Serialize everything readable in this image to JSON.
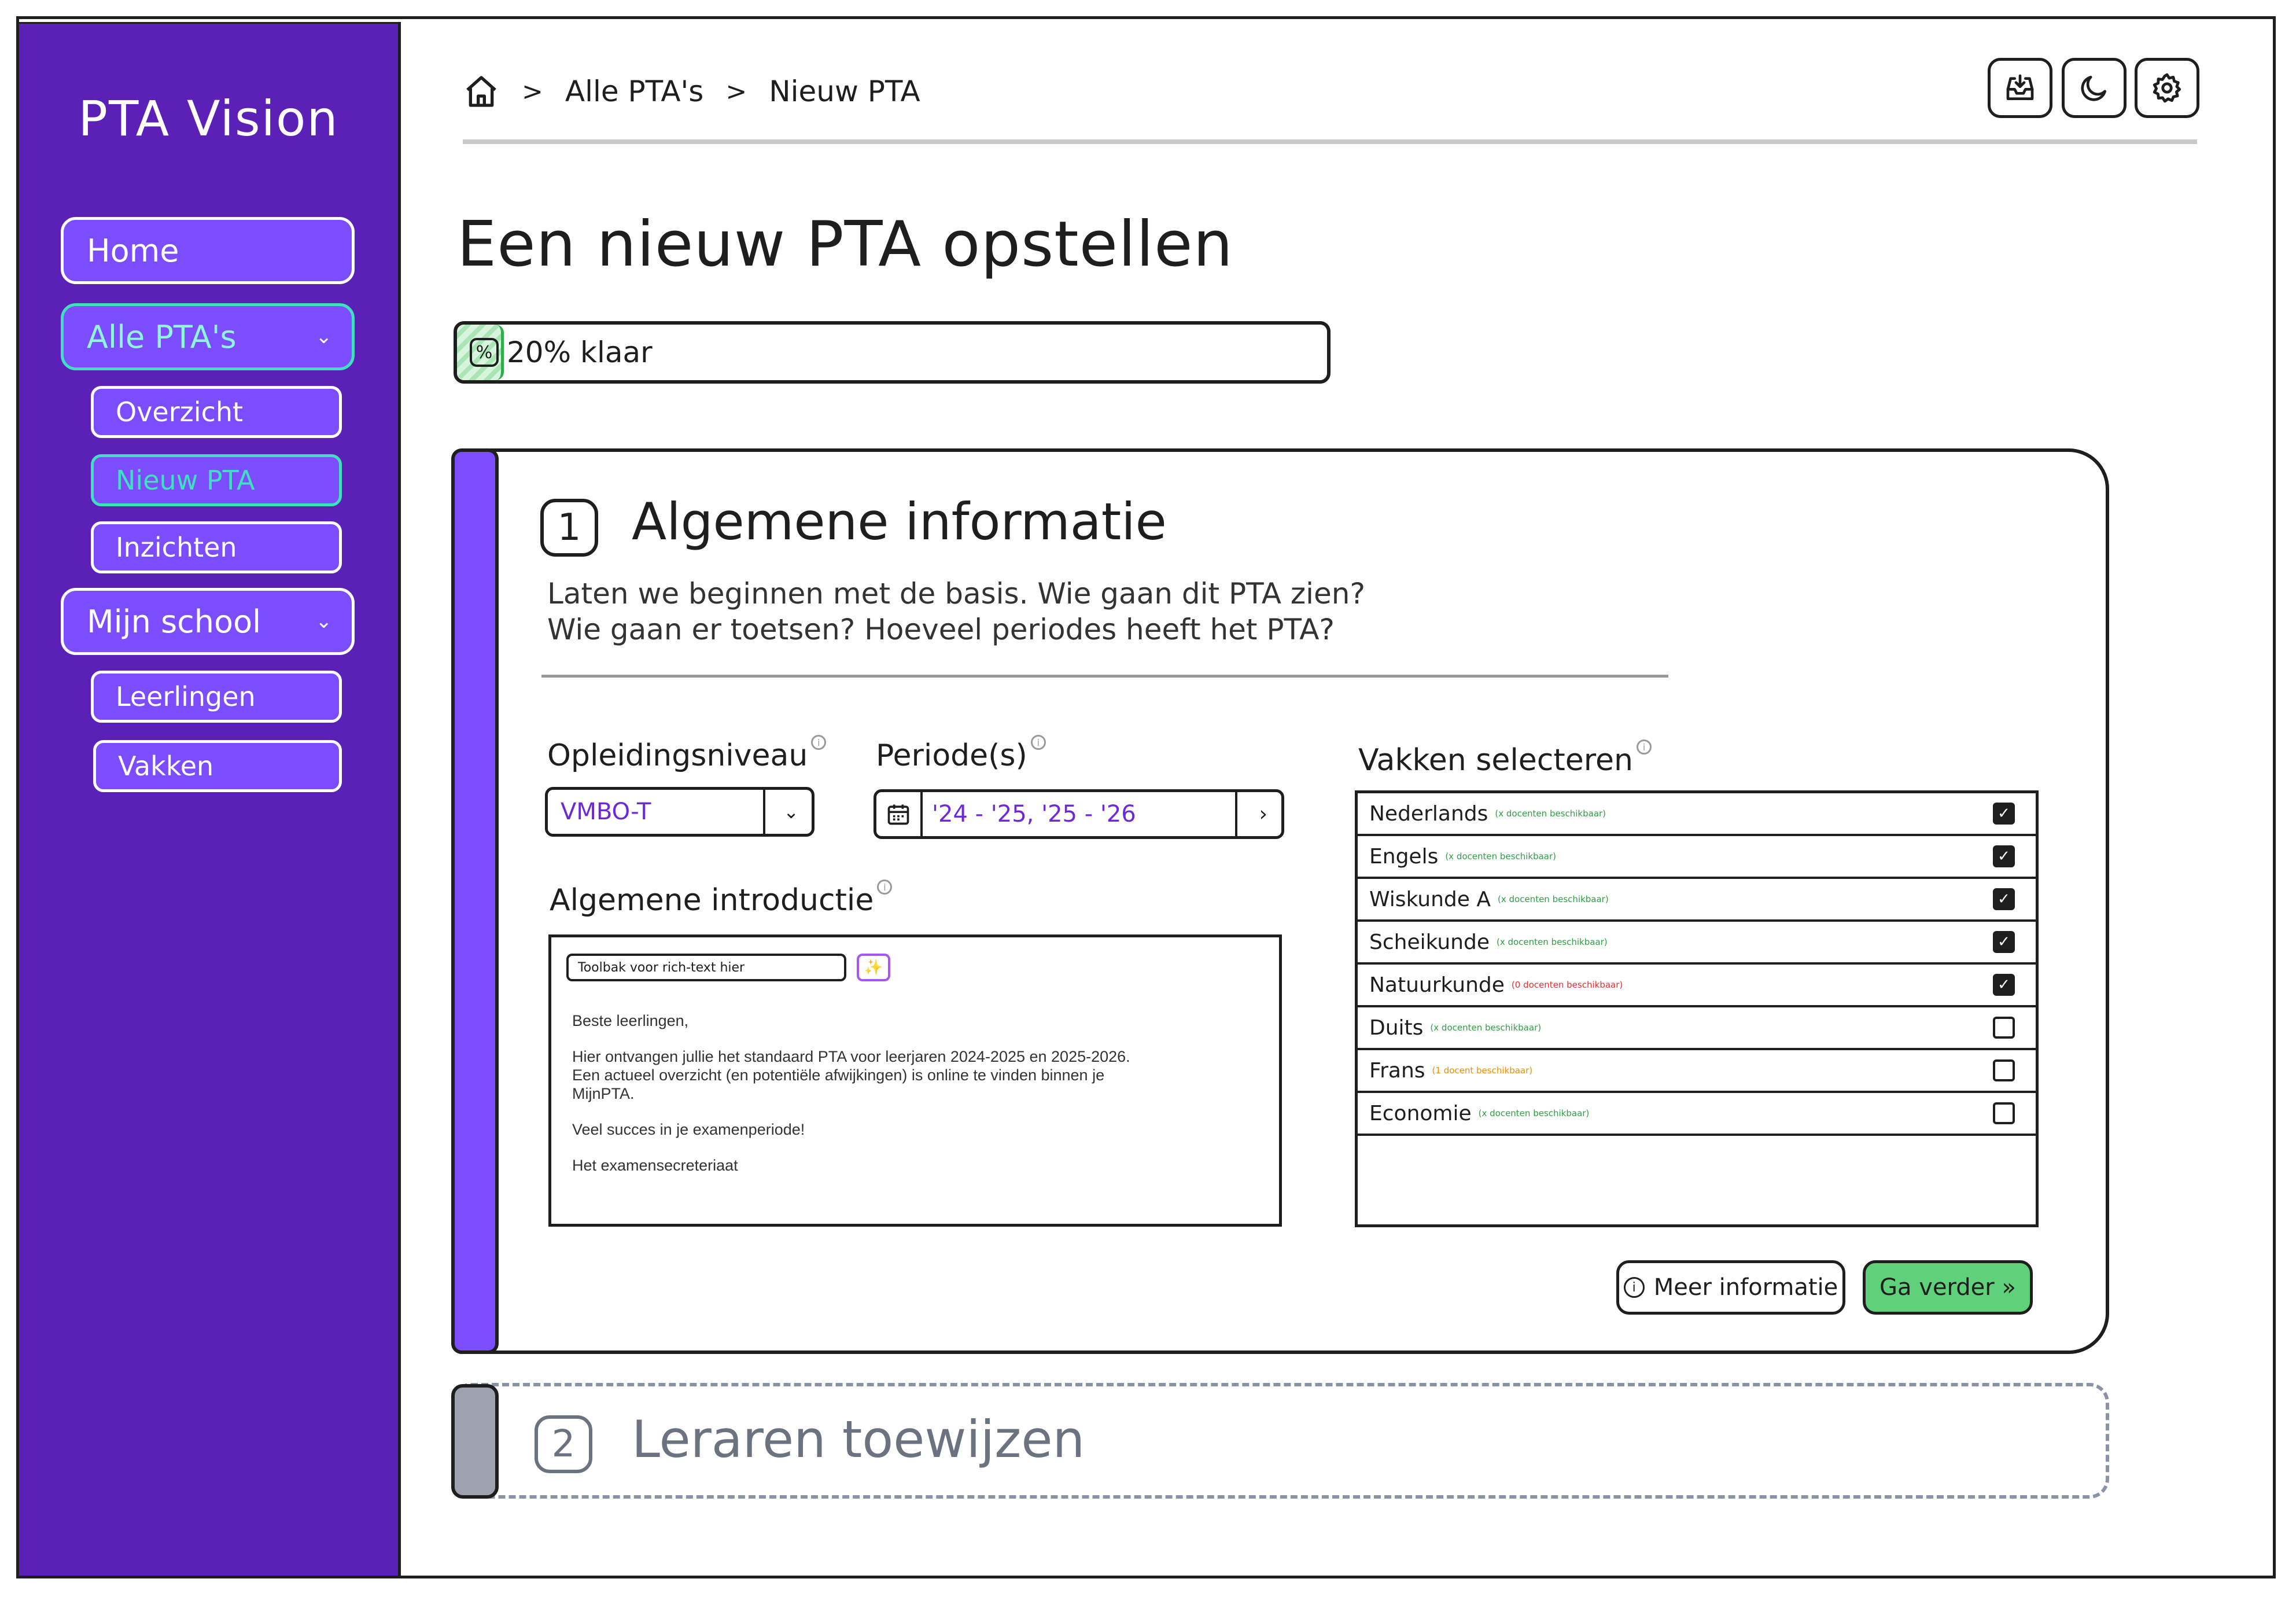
{
  "app": {
    "title": "PTA Vision"
  },
  "sidebar": {
    "items": [
      {
        "label": "Home"
      },
      {
        "label": "Alle PTA's",
        "expanded": true,
        "children": [
          {
            "label": "Overzicht"
          },
          {
            "label": "Nieuw PTA",
            "active": true
          },
          {
            "label": "Inzichten"
          }
        ]
      },
      {
        "label": "Mijn school",
        "expanded": true,
        "children": [
          {
            "label": "Leerlingen"
          },
          {
            "label": "Vakken"
          }
        ]
      }
    ]
  },
  "breadcrumb": {
    "home_icon": "home-icon",
    "separator": ">",
    "items": [
      "Alle PTA's",
      "Nieuw PTA"
    ]
  },
  "toolbar": {
    "icons": [
      "inbox-download-icon",
      "moon-icon",
      "gear-icon"
    ]
  },
  "page": {
    "title": "Een nieuw PTA opstellen"
  },
  "progress": {
    "percent": 20,
    "label": "20% klaar",
    "icon": "percent-icon"
  },
  "step1": {
    "number": "1",
    "title": "Algemene informatie",
    "description": [
      "Laten we beginnen met de basis. Wie gaan dit PTA zien?",
      "Wie gaan er toetsen? Hoeveel periodes heeft het PTA?"
    ],
    "level": {
      "label": "Opleidingsniveau",
      "value": "VMBO-T"
    },
    "period": {
      "label": "Periode(s)",
      "value": "'24 - '25, '25 - '26"
    },
    "intro": {
      "label": "Algemene introductie",
      "toolbar_placeholder": "Toolbak voor rich-text hier",
      "paragraphs": [
        "Beste leerlingen,",
        "Hier ontvangen jullie het standaard PTA voor leerjaren 2024-2025 en 2025-2026. Een actueel overzicht (en potentiële afwijkingen) is online te vinden binnen je MijnPTA.",
        "Veel succes in je examenperiode!",
        "Het examensecreteriaat"
      ]
    },
    "subjects": {
      "label": "Vakken selecteren",
      "items": [
        {
          "name": "Nederlands",
          "note": "(x docenten beschikbaar)",
          "note_color": "#2f9e44",
          "checked": true
        },
        {
          "name": "Engels",
          "note": "(x docenten beschikbaar)",
          "note_color": "#2f9e44",
          "checked": true
        },
        {
          "name": "Wiskunde A",
          "note": "(x docenten beschikbaar)",
          "note_color": "#2f9e44",
          "checked": true
        },
        {
          "name": "Scheikunde",
          "note": "(x docenten beschikbaar)",
          "note_color": "#2f9e44",
          "checked": true
        },
        {
          "name": "Natuurkunde",
          "note": "(0 docenten beschikbaar)",
          "note_color": "#e03131",
          "checked": true
        },
        {
          "name": "Duits",
          "note": "(x docenten beschikbaar)",
          "note_color": "#2f9e44",
          "checked": false
        },
        {
          "name": "Frans",
          "note": "(1 docent beschikbaar)",
          "note_color": "#f08c00",
          "checked": false
        },
        {
          "name": "Economie",
          "note": "(x docenten beschikbaar)",
          "note_color": "#2f9e44",
          "checked": false
        }
      ]
    },
    "buttons": {
      "info": "Meer informatie",
      "next": "Ga verder »"
    }
  },
  "step2": {
    "number": "2",
    "title": "Leraren toewijzen"
  },
  "colors": {
    "sidebar": "#5b21b6",
    "nav_button": "#7c4dff",
    "accent_teal": "#3fdfc0",
    "success": "#5fd17a",
    "value_text": "#6d28d9"
  }
}
